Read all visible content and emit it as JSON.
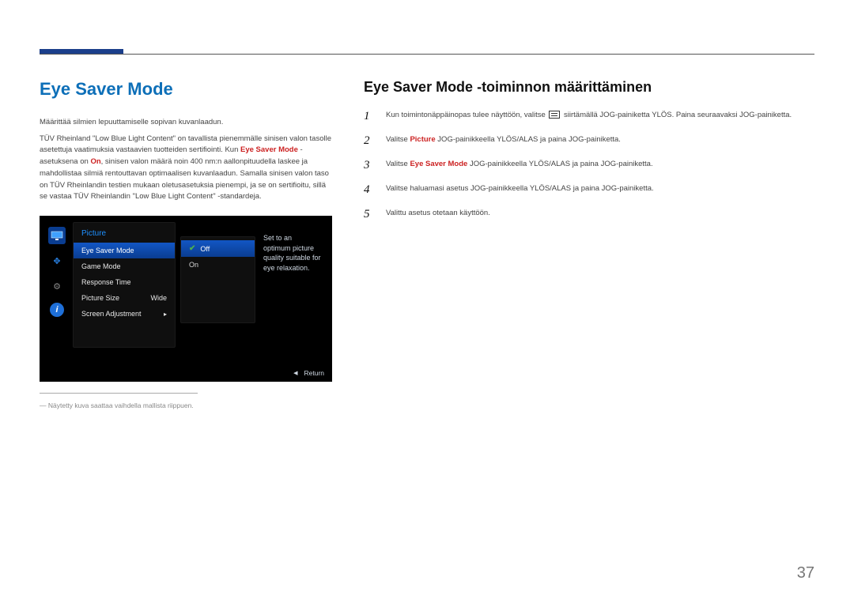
{
  "page_number": "37",
  "left": {
    "heading": "Eye Saver Mode",
    "p1": "Määrittää silmien lepuuttamiselle sopivan kuvanlaadun.",
    "p2_pre": "TÜV Rheinland \"Low Blue Light Content\" on tavallista pienemmälle sinisen valon tasolle asetettuja vaatimuksia vastaavien tuotteiden sertifiointi. Kun ",
    "p2_bold1": "Eye Saver Mode",
    "p2_mid": " -asetuksena on ",
    "p2_bold2": "On",
    "p2_post": ", sinisen valon määrä noin 400 nm:n aallonpituudella laskee ja mahdollistaa silmiä rentouttavan optimaalisen kuvanlaadun. Samalla sinisen valon taso on TÜV Rheinlandin testien mukaan oletusasetuksia pienempi, ja se on sertifioitu, sillä se vastaa TÜV Rheinlandin \"Low Blue Light Content\" -standardeja.",
    "footnote": "Näytetty kuva saattaa vaihdella mallista riippuen."
  },
  "osd": {
    "menu_title": "Picture",
    "rows": [
      {
        "label": "Eye Saver Mode",
        "value": ""
      },
      {
        "label": "Game Mode",
        "value": ""
      },
      {
        "label": "Response Time",
        "value": ""
      },
      {
        "label": "Picture Size",
        "value": "Wide"
      },
      {
        "label": "Screen Adjustment",
        "value": "▸"
      }
    ],
    "options": [
      {
        "label": "Off",
        "selected": true
      },
      {
        "label": "On",
        "selected": false
      }
    ],
    "description": "Set to an optimum picture quality suitable for eye relaxation.",
    "return_label": "Return"
  },
  "right": {
    "heading": "Eye Saver Mode -toiminnon määrittäminen",
    "steps": {
      "s1_pre": "Kun toimintonäppäinopas tulee näyttöön, valitse ",
      "s1_post": " siirtämällä JOG-painiketta YLÖS. Paina seuraavaksi JOG-painiketta.",
      "s2_pre": "Valitse ",
      "s2_red": "Picture",
      "s2_post": " JOG-painikkeella YLÖS/ALAS ja paina JOG-painiketta.",
      "s3_pre": "Valitse ",
      "s3_red": "Eye Saver Mode",
      "s3_post": " JOG-painikkeella YLÖS/ALAS ja paina JOG-painiketta.",
      "s4": "Valitse haluamasi asetus JOG-painikkeella YLÖS/ALAS ja paina JOG-painiketta.",
      "s5": "Valittu asetus otetaan käyttöön."
    },
    "nums": {
      "n1": "1",
      "n2": "2",
      "n3": "3",
      "n4": "4",
      "n5": "5"
    }
  }
}
